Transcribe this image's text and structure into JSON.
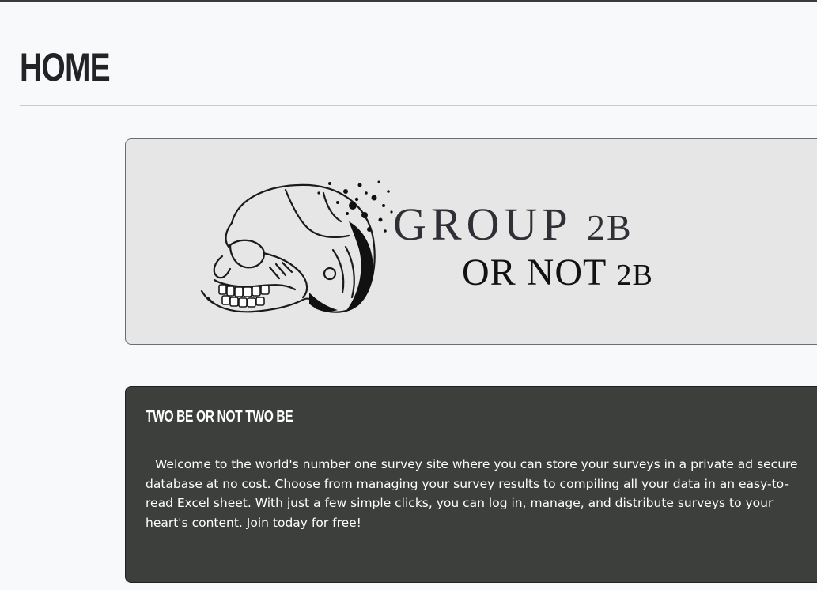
{
  "page": {
    "title": "HOME"
  },
  "banner": {
    "logo_line1_main": "GROUP ",
    "logo_line1_small": "2B",
    "logo_line2_main": "OR NOT ",
    "logo_line2_small": "2B",
    "icon": "skull-icon"
  },
  "info_card": {
    "heading": "TWO BE OR NOT TWO BE",
    "body": "Welcome to the world's number one survey site where you can store your surveys in a private ad secure database at no cost. Choose from managing your survey results to compiling all your data in an easy-to-read Excel sheet. With just a few simple clicks, you can log in, manage, and distribute surveys to your heart's content. Join today for free!"
  },
  "colors": {
    "page_background": "#f8f9fb",
    "banner_background": "#e7e6e6",
    "card_background": "#3c3f3c",
    "title_text": "#222326"
  }
}
